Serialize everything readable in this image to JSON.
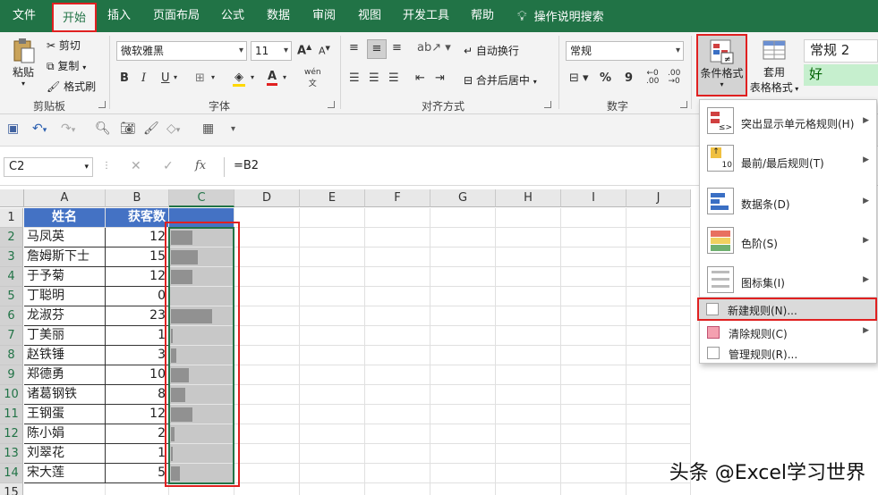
{
  "tabs": [
    {
      "label": "文件"
    },
    {
      "label": "开始"
    },
    {
      "label": "插入"
    },
    {
      "label": "页面布局"
    },
    {
      "label": "公式"
    },
    {
      "label": "数据"
    },
    {
      "label": "审阅"
    },
    {
      "label": "视图"
    },
    {
      "label": "开发工具"
    },
    {
      "label": "帮助"
    }
  ],
  "tell_me": "操作说明搜索",
  "ribbon": {
    "clipboard": {
      "group": "剪贴板",
      "paste": "粘贴",
      "cut": "剪切",
      "copy": "复制",
      "format_painter": "格式刷"
    },
    "font": {
      "group": "字体",
      "family": "微软雅黑",
      "size": "11",
      "bold": "B",
      "italic": "I",
      "underline": "U",
      "grow": "A",
      "shrink": "A",
      "wen": "wén"
    },
    "alignment": {
      "group": "对齐方式",
      "wrap": "自动换行",
      "merge": "合并后居中"
    },
    "number": {
      "group": "数字",
      "format": "常规",
      "percent": "%",
      "comma": "9"
    },
    "styles": {
      "conditional": "条件格式",
      "table_line1": "套用",
      "table_line2": "表格格式",
      "style_normal2": "常规 2",
      "style_good": "好"
    }
  },
  "formula_bar": {
    "name_box": "C2",
    "fx": "fx",
    "formula": "=B2"
  },
  "grid": {
    "columns": [
      "A",
      "B",
      "C",
      "D",
      "E",
      "F",
      "G",
      "H",
      "I",
      "J"
    ],
    "rows": [
      "1",
      "2",
      "3",
      "4",
      "5",
      "6",
      "7",
      "8",
      "9",
      "10",
      "11",
      "12",
      "13",
      "14",
      "15"
    ],
    "header": {
      "a": "姓名",
      "b": "获客数"
    },
    "records": [
      {
        "name": "马凤英",
        "value": 12
      },
      {
        "name": "詹姆斯下士",
        "value": 15
      },
      {
        "name": "于予菊",
        "value": 12
      },
      {
        "name": "丁聪明",
        "value": 0
      },
      {
        "name": "龙淑芬",
        "value": 23
      },
      {
        "name": "丁美丽",
        "value": 1
      },
      {
        "name": "赵铁锤",
        "value": 3
      },
      {
        "name": "郑德勇",
        "value": 10
      },
      {
        "name": "诸葛钢铁",
        "value": 8
      },
      {
        "name": "王钢蛋",
        "value": 12
      },
      {
        "name": "陈小娟",
        "value": 2
      },
      {
        "name": "刘翠花",
        "value": 1
      },
      {
        "name": "宋大莲",
        "value": 5
      }
    ]
  },
  "cf_menu": {
    "items": [
      {
        "label": "突出显示单元格规则(H)"
      },
      {
        "label": "最前/最后规则(T)"
      },
      {
        "label": "数据条(D)"
      },
      {
        "label": "色阶(S)"
      },
      {
        "label": "图标集(I)"
      }
    ],
    "new_rule": "新建规则(N)...",
    "clear_rules": "清除规则(C)",
    "manage_rules": "管理规则(R)..."
  },
  "colors": {
    "excel_green": "#217346",
    "highlight_red": "#e02020",
    "header_blue": "#4472c4",
    "databar_gray": "#919191"
  },
  "watermark": "头条 @Excel学习世界"
}
